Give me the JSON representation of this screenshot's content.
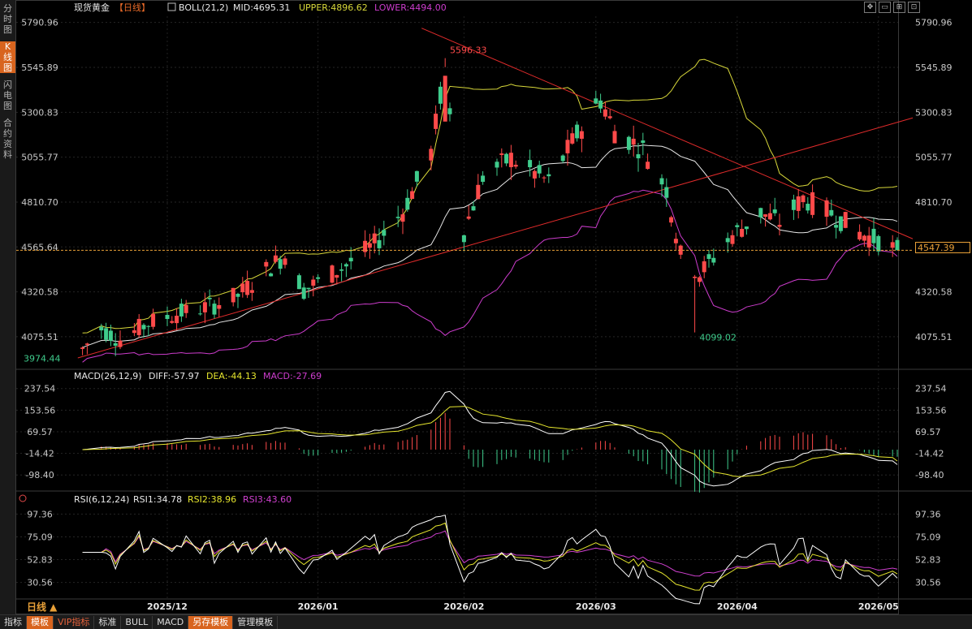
{
  "sidebar": {
    "items": [
      {
        "label": "分时图",
        "active": false
      },
      {
        "label": "K线图",
        "active": true
      },
      {
        "label": "闪电图",
        "active": false
      },
      {
        "label": "合约资料",
        "active": false
      }
    ]
  },
  "bottom_tabs": [
    {
      "label": "指标",
      "active": false
    },
    {
      "label": "模板",
      "active": true
    },
    {
      "label": "VIP指标",
      "active": false,
      "vip": true
    },
    {
      "label": "标准",
      "active": false
    },
    {
      "label": "BULL",
      "active": false
    },
    {
      "label": "MACD",
      "active": false
    },
    {
      "label": "另存模板",
      "active": true
    },
    {
      "label": "管理模板",
      "active": false
    }
  ],
  "tools": [
    "move-icon",
    "zoom-out-icon",
    "zoom-in-icon",
    "restore-icon"
  ],
  "tool_glyphs": [
    "✥",
    "▭",
    "⊞",
    "⊡"
  ],
  "period_label": "日线 ▲",
  "current_price": "4547.39",
  "colors": {
    "up": "#ff4a4a",
    "down": "#3fcc8c",
    "mid": "#e8e8e8",
    "upper": "#d8d83a",
    "lower": "#cc3ccc",
    "trend": "#e02b2b",
    "diff": "#ffffff",
    "dea": "#e6e62e",
    "rsi1": "#ffffff",
    "rsi2": "#e6e62e",
    "rsi3": "#d040d0"
  },
  "chart_data": [
    {
      "type": "candlestick",
      "title": "现货黄金",
      "period": "【日线】",
      "indicator": "BOLL(21,2)",
      "legend": [
        "MID:4695.31",
        "UPPER:4896.62",
        "LOWER:4494.00"
      ],
      "y_ticks": [
        "5790.96",
        "5545.89",
        "5300.83",
        "5055.77",
        "4810.70",
        "4565.64",
        "4320.58",
        "4075.51"
      ],
      "ylim": [
        3920,
        5825
      ],
      "x_tick_labels": [
        "2025/12",
        "2026/01",
        "2026/02",
        "2026/03",
        "2026/04",
        "2026/05"
      ],
      "annotations": {
        "high": "5596.33",
        "low": "4099.02",
        "start_low": "3974.44"
      },
      "key_points": {
        "start_low": 3974.44,
        "peak": 5596.33,
        "dip": 4099.02,
        "last": 4547.39
      },
      "approx_path": [
        {
          "date": "2025-11-13",
          "close": 4010
        },
        {
          "date": "2025-11-17",
          "close": 4120
        },
        {
          "date": "2025-11-21",
          "close": 4060
        },
        {
          "date": "2025-11-27",
          "close": 4150
        },
        {
          "date": "2025-12-03",
          "close": 4200
        },
        {
          "date": "2025-12-10",
          "close": 4240
        },
        {
          "date": "2025-12-16",
          "close": 4300
        },
        {
          "date": "2025-12-22",
          "close": 4440
        },
        {
          "date": "2025-12-26",
          "close": 4520
        },
        {
          "date": "2025-12-30",
          "close": 4330
        },
        {
          "date": "2026-01-07",
          "close": 4450
        },
        {
          "date": "2026-01-14",
          "close": 4580
        },
        {
          "date": "2026-01-20",
          "close": 4760
        },
        {
          "date": "2026-01-26",
          "close": 5080
        },
        {
          "date": "2026-01-29",
          "close": 5550
        },
        {
          "date": "2026-02-02",
          "close": 4650
        },
        {
          "date": "2026-02-06",
          "close": 4950
        },
        {
          "date": "2026-02-12",
          "close": 5050
        },
        {
          "date": "2026-02-20",
          "close": 4920
        },
        {
          "date": "2026-02-26",
          "close": 5180
        },
        {
          "date": "2026-03-03",
          "close": 5370
        },
        {
          "date": "2026-03-06",
          "close": 5200
        },
        {
          "date": "2026-03-12",
          "close": 5100
        },
        {
          "date": "2026-03-17",
          "close": 4880
        },
        {
          "date": "2026-03-20",
          "close": 4520
        },
        {
          "date": "2026-03-24",
          "close": 4420
        },
        {
          "date": "2026-03-31",
          "close": 4630
        },
        {
          "date": "2026-04-06",
          "close": 4750
        },
        {
          "date": "2026-04-10",
          "close": 4700
        },
        {
          "date": "2026-04-15",
          "close": 4830
        },
        {
          "date": "2026-04-21",
          "close": 4750
        },
        {
          "date": "2026-04-27",
          "close": 4640
        },
        {
          "date": "2026-05-01",
          "close": 4600
        },
        {
          "date": "2026-05-05",
          "close": 4547.39
        }
      ]
    },
    {
      "type": "macd",
      "title": "MACD(26,12,9)",
      "legend": [
        "DIFF:-57.97",
        "DEA:-44.13",
        "MACD:-27.69"
      ],
      "y_ticks": [
        "237.54",
        "153.56",
        "69.57",
        "-14.42",
        "-98.40"
      ],
      "ylim": [
        -145,
        265
      ],
      "last": {
        "diff": -57.97,
        "dea": -44.13,
        "macd": -27.69
      }
    },
    {
      "type": "rsi",
      "title": "RSI(6,12,24)",
      "legend": [
        "RSI1:34.78",
        "RSI2:38.96",
        "RSI3:43.60"
      ],
      "y_ticks": [
        "97.36",
        "75.09",
        "52.83",
        "30.56"
      ],
      "ylim": [
        16,
        108
      ],
      "last": {
        "rsi1": 34.78,
        "rsi2": 38.96,
        "rsi3": 43.6
      }
    }
  ]
}
